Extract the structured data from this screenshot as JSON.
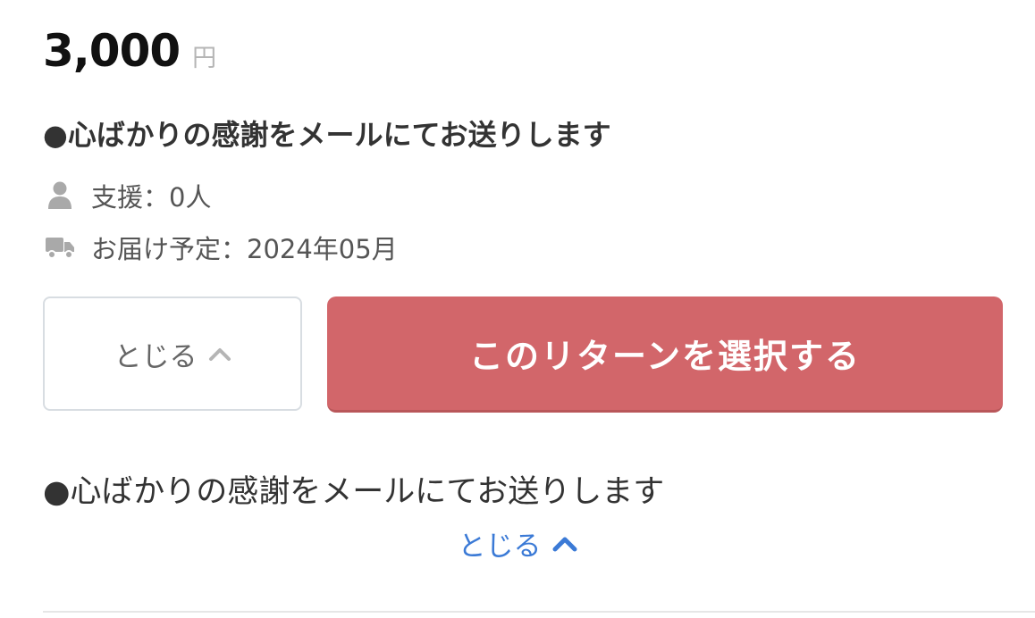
{
  "reward": {
    "price_amount": "3,000",
    "price_unit": "円",
    "title": "●心ばかりの感謝をメールにてお送りします",
    "supporters_text": "支援：0人",
    "delivery_text": "お届け予定：2024年05月",
    "description": "●心ばかりの感謝をメールにてお送りします"
  },
  "buttons": {
    "close_label": "とじる",
    "select_label": "このリターンを選択する",
    "close_link_label": "とじる"
  },
  "icons": {
    "supporters": "person-icon",
    "delivery": "truck-icon",
    "close_chevron": "chevron-up-icon",
    "link_chevron": "chevron-up-icon"
  },
  "colors": {
    "select_button_bg": "#d2666a",
    "link": "#3b7ad6",
    "icon_gray": "#a9a9a9"
  }
}
